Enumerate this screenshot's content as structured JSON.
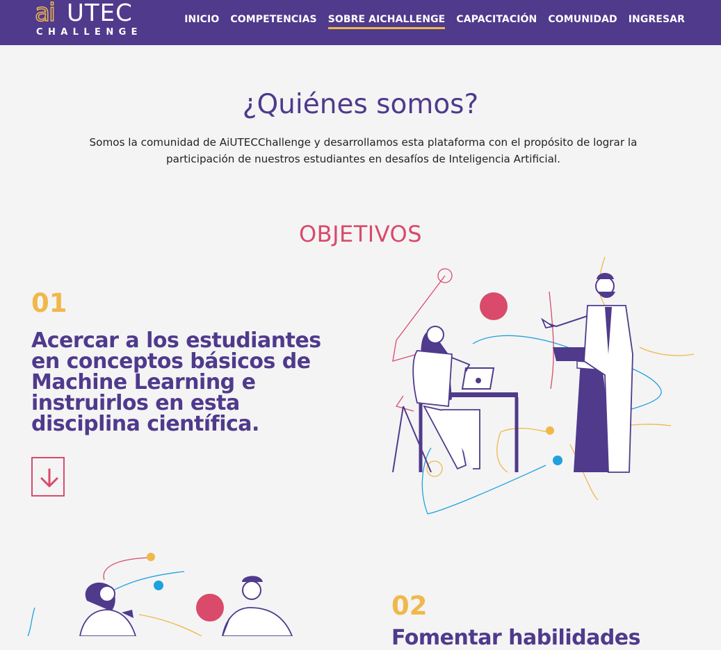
{
  "brand": {
    "logo_ai": "ai",
    "logo_utec": "UTEC",
    "logo_challenge": "CHALLENGE"
  },
  "nav": {
    "items": [
      {
        "label": "INICIO"
      },
      {
        "label": "COMPETENCIAS"
      },
      {
        "label": "SOBRE AICHALLENGE",
        "active": true
      },
      {
        "label": "CAPACITACIÓN"
      },
      {
        "label": "COMUNIDAD"
      },
      {
        "label": "INGRESAR"
      }
    ]
  },
  "about": {
    "title": "¿Quiénes somos?",
    "text": "Somos la comunidad de AiUTECChallenge y desarrollamos esta plataforma con el propósito de lograr la participación de nuestros estudiantes en desafíos de Inteligencia Artificial."
  },
  "objectives": {
    "title": "OBJETIVOS",
    "items": [
      {
        "number": "01",
        "text": "Acercar a los estudiantes en conceptos básicos de Machine Learning e instruirlos en esta disciplina científica.",
        "button_icon": "arrow-down-icon"
      },
      {
        "number": "02",
        "text": "Fomentar habilidades"
      }
    ]
  },
  "colors": {
    "primary": "#4f3a8c",
    "accent_yellow": "#f0b84a",
    "accent_pink": "#d94a6b",
    "accent_blue": "#1fa1de",
    "background": "#f4f4f4"
  }
}
